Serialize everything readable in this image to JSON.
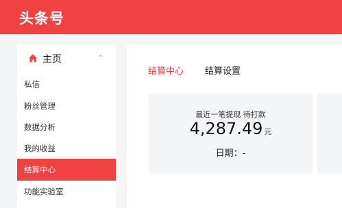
{
  "header": {
    "logo": "头条号",
    "color": "#f04142"
  },
  "sidebar": {
    "home_label": "主页",
    "items": [
      {
        "label": "私信"
      },
      {
        "label": "粉丝管理"
      },
      {
        "label": "数据分析"
      },
      {
        "label": "我的收益"
      },
      {
        "label": "结算中心",
        "active": true
      },
      {
        "label": "功能实验室"
      }
    ]
  },
  "main": {
    "tabs": [
      {
        "label": "结算中心",
        "active": true
      },
      {
        "label": "结算设置",
        "active": false
      }
    ],
    "card": {
      "label": "最近一笔提现 待打款",
      "amount": "4,287.49",
      "unit": "元",
      "date": "日期：-"
    }
  }
}
